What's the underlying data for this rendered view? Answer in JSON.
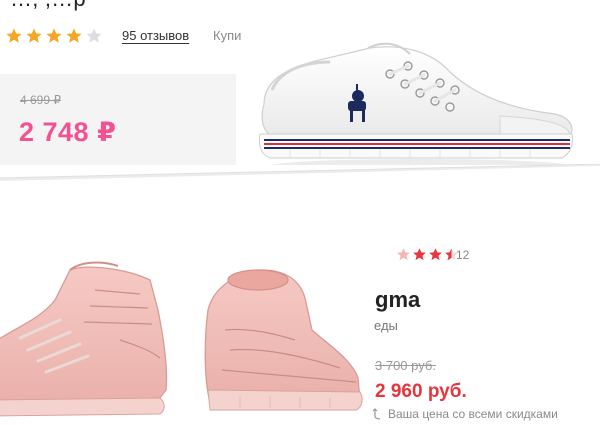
{
  "top_product": {
    "title_fragment": "…, ,…р",
    "rating": {
      "value": 4,
      "max": 5
    },
    "reviews_link": "95 отзывов",
    "buy_hint": "Купи",
    "old_price": "4 699 ₽",
    "new_price": "2 748 ₽",
    "colors": {
      "price": "#f25293",
      "star": "#f5a623",
      "star_empty": "#dddddd"
    }
  },
  "bottom_product": {
    "rating": {
      "value": 3.5,
      "max": 5
    },
    "rating_count": "12",
    "brand_fragment": "gma",
    "subtitle_fragment": "еды",
    "old_price": "3 700 руб.",
    "new_price": "2 960 руб.",
    "discount_note": "Ваша цена со всеми скидками",
    "colors": {
      "price": "#e8343c",
      "star": "#e8343c"
    }
  }
}
